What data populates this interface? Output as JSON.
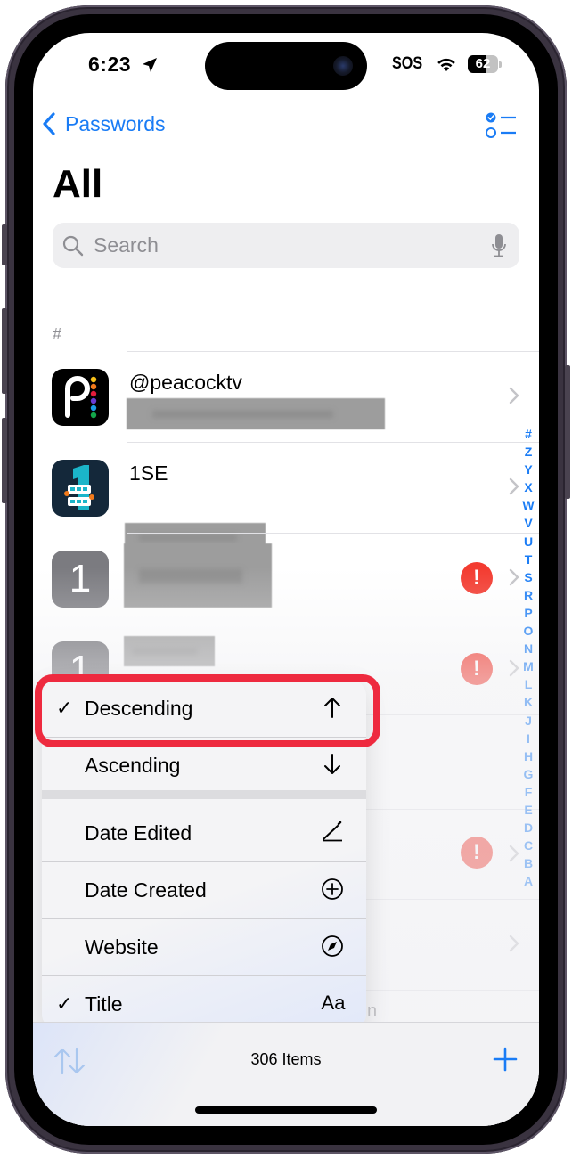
{
  "status_bar": {
    "time": "6:23",
    "carrier": "SOS",
    "battery_percent": 62,
    "battery_label": "62",
    "icons": [
      "location-arrow-icon",
      "wifi-icon",
      "battery-icon"
    ]
  },
  "nav": {
    "back_label": "Passwords",
    "back_icon": "chevron-left-icon",
    "select_icon": "checklist-icon"
  },
  "page": {
    "title": "All"
  },
  "search": {
    "placeholder": "Search",
    "value": "",
    "icon": "magnifying-glass-icon",
    "mic_icon": "microphone-icon"
  },
  "list": {
    "section_header": "#",
    "rows": [
      {
        "title": "@peacocktv",
        "icon": "peacock-app-icon",
        "subtitle_redacted": true,
        "warning": false
      },
      {
        "title": "1SE",
        "icon": "1se-app-icon",
        "subtitle_redacted": true,
        "warning": false
      },
      {
        "title": "",
        "icon": "number-1-placeholder-icon",
        "icon_text": "1",
        "subtitle_redacted": true,
        "warning": true
      },
      {
        "title": "",
        "icon": "number-1-placeholder-icon",
        "icon_text": "1",
        "subtitle_redacted": true,
        "warning": true
      },
      {
        "title": "",
        "subtitle_redacted": true,
        "warning": false
      },
      {
        "title": "",
        "subtitle_redacted": true,
        "warning": true
      },
      {
        "title": "",
        "subtitle_redacted": true,
        "warning": false
      },
      {
        "title": "",
        "subtitle_fragment": "n",
        "warning": false
      }
    ],
    "warning_glyph": "!",
    "index_letters": [
      "#",
      "Z",
      "Y",
      "X",
      "W",
      "V",
      "U",
      "T",
      "S",
      "R",
      "P",
      "O",
      "N",
      "M",
      "L",
      "K",
      "J",
      "I",
      "H",
      "G",
      "F",
      "E",
      "D",
      "C",
      "B",
      "A"
    ]
  },
  "sort_menu": {
    "items": [
      {
        "label": "Descending",
        "checked": true,
        "check": "✓",
        "icon": "arrow-up-icon",
        "highlighted": true
      },
      {
        "label": "Ascending",
        "checked": false,
        "check": "",
        "icon": "arrow-down-icon"
      },
      {
        "label": "Date Edited",
        "checked": false,
        "check": "",
        "icon": "pencil-line-icon"
      },
      {
        "label": "Date Created",
        "checked": false,
        "check": "",
        "icon": "plus-circle-icon"
      },
      {
        "label": "Website",
        "checked": false,
        "check": "",
        "icon": "compass-icon"
      },
      {
        "label": "Title",
        "checked": true,
        "check": "✓",
        "icon": "text-format-icon",
        "glyph": "Aa"
      }
    ]
  },
  "toolbar": {
    "items_count": "306 Items",
    "sort_icon": "sort-arrows-icon",
    "add_icon": "plus-icon"
  },
  "colors": {
    "accent": "#1a7cf5",
    "warning": "#f33b30",
    "highlight_ring": "#ee2a3f"
  }
}
